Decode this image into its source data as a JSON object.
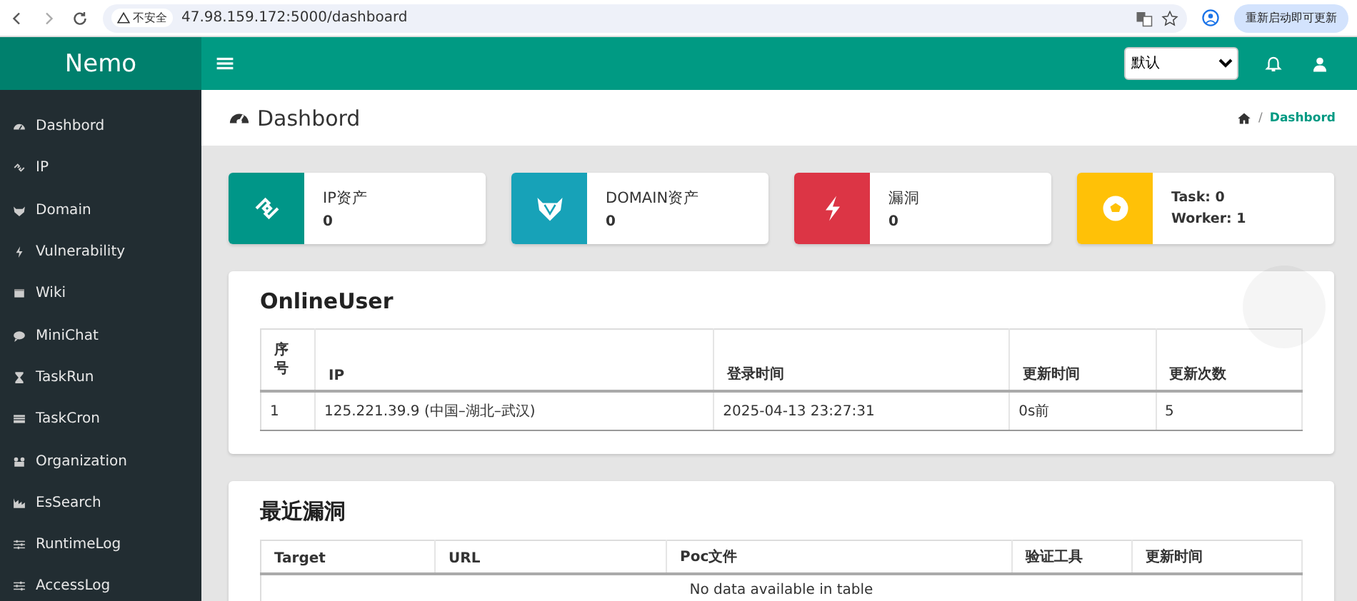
{
  "browser": {
    "security_label": "不安全",
    "url": "47.98.159.172:5000/dashboard",
    "update_button": "重新启动即可更新"
  },
  "app": {
    "brand": "Nemo",
    "language_select": {
      "value": "默认"
    }
  },
  "sidebar": {
    "items": [
      {
        "label": "Dashbord"
      },
      {
        "label": "IP"
      },
      {
        "label": "Domain"
      },
      {
        "label": "Vulnerability"
      },
      {
        "label": "Wiki"
      },
      {
        "label": "MiniChat"
      },
      {
        "label": "TaskRun"
      },
      {
        "label": "TaskCron"
      },
      {
        "label": "Organization"
      },
      {
        "label": "EsSearch"
      },
      {
        "label": "RuntimeLog"
      },
      {
        "label": "AccessLog"
      }
    ]
  },
  "page": {
    "title": "Dashbord",
    "breadcrumb": {
      "separator": "/",
      "current": "Dashbord"
    }
  },
  "info_boxes": [
    {
      "kind": "count",
      "label": "IP资产",
      "value": "0",
      "color": "#009688"
    },
    {
      "kind": "count",
      "label": "DOMAIN资产",
      "value": "0",
      "color": "#17a2b8"
    },
    {
      "kind": "count",
      "label": "漏洞",
      "value": "0",
      "color": "#dc3545"
    },
    {
      "kind": "lines",
      "lines": [
        "Task: 0",
        "Worker: 1"
      ],
      "color": "#ffc107"
    }
  ],
  "online_user": {
    "title": "OnlineUser",
    "columns": [
      "序号",
      "IP",
      "登录时间",
      "更新时间",
      "更新次数"
    ],
    "rows": [
      [
        "1",
        "125.221.39.9 (中国–湖北–武汉)",
        "2025-04-13 23:27:31",
        "0s前",
        "5"
      ]
    ]
  },
  "recent_vulnerabilities": {
    "title": "最近漏洞",
    "columns": [
      "Target",
      "URL",
      "Poc文件",
      "验证工具",
      "更新时间"
    ],
    "empty_message": "No data available in table"
  }
}
